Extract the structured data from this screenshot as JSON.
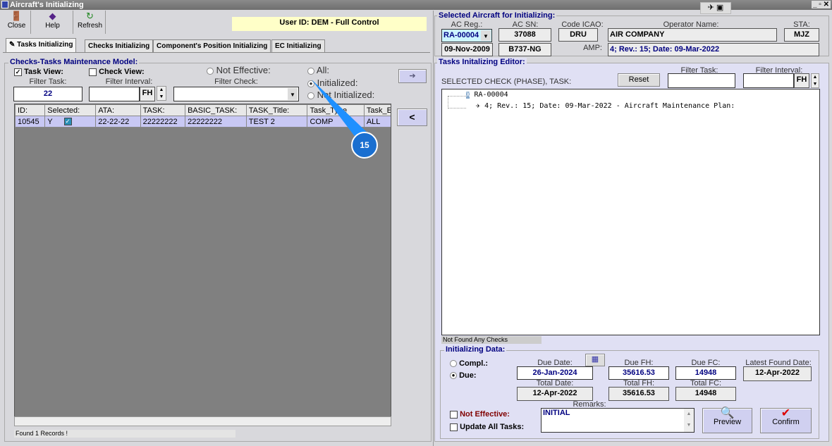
{
  "window": {
    "title": "Aircraft's Initializing"
  },
  "toolbar": {
    "close": "Close",
    "help": "Help",
    "refresh": "Refresh",
    "user": "User ID: DEM - Full Control"
  },
  "tabs": [
    "Tasks Initializing",
    "Checks Initializing",
    "Component's Position Initializing",
    "EC Initializing"
  ],
  "model": {
    "title": "Checks-Tasks Maintenance Model:",
    "task_view": "Task View:",
    "check_view": "Check View:",
    "not_effective": "Not Effective:",
    "all": "All:",
    "initialized": "Initialized:",
    "not_initialized": "Not Initialized:",
    "filter_task_label": "Filter Task:",
    "filter_task": "22",
    "filter_interval_label": "Filter Interval:",
    "fh": "FH",
    "filter_check_label": "Filter Check:",
    "arrow_right": "➔",
    "arrow_left": "<"
  },
  "grid": {
    "columns": [
      "ID:",
      "Selected:",
      "ATA:",
      "TASK:",
      "BASIC_TASK:",
      "TASK_Title:",
      "Task_Type",
      "Task_Effec"
    ],
    "rows": [
      [
        "10545",
        "Y",
        "22-22-22",
        "22222222",
        "22222222",
        "TEST 2",
        "COMP",
        "ALL"
      ]
    ],
    "status": "Found 1 Records !"
  },
  "callout": "15",
  "aircraft": {
    "title": "Selected Aircraft for Initializing:",
    "reg_label": "AC Reg.:",
    "reg": "RA-00004",
    "sn_label": "AC SN:",
    "sn": "37088",
    "icao_label": "Code ICAO:",
    "icao": "DRU",
    "op_label": "Operator Name:",
    "op": "AIR COMPANY",
    "sta_label": "STA:",
    "sta": "MJZ",
    "date": "09-Nov-2009",
    "type": "B737-NG",
    "amp_label": "AMP:",
    "amp": "4; Rev.: 15; Date: 09-Mar-2022"
  },
  "editor": {
    "title": "Tasks Initalizing Editor:",
    "selected": "SELECTED CHECK (PHASE), TASK:",
    "reset": "Reset",
    "filter_task": "Filter Task:",
    "filter_interval": "Filter Interval:",
    "fh": "FH",
    "tree": [
      "RA-00004",
      "4; Rev.: 15; Date: 09-Mar-2022 - Aircraft Maintenance Plan:"
    ],
    "status": "Not Found Any Checks"
  },
  "init": {
    "title": "Initializing Data:",
    "compl": "Compl.:",
    "due": "Due:",
    "due_date_label": "Due Date:",
    "due_date": "26-Jan-2024",
    "due_fh_label": "Due FH:",
    "due_fh": "35616.53",
    "due_fc_label": "Due FC:",
    "due_fc": "14948",
    "latest_label": "Latest Found Date:",
    "latest": "12-Apr-2022",
    "total_date_label": "Total Date:",
    "total_date": "12-Apr-2022",
    "total_fh_label": "Total FH:",
    "total_fh": "35616.53",
    "total_fc_label": "Total FC:",
    "total_fc": "14948",
    "remarks_label": "Remarks:",
    "remarks": "INITIAL",
    "not_effective": "Not Effective:",
    "update_all": "Update All Tasks:",
    "preview": "Preview",
    "confirm": "Confirm"
  }
}
